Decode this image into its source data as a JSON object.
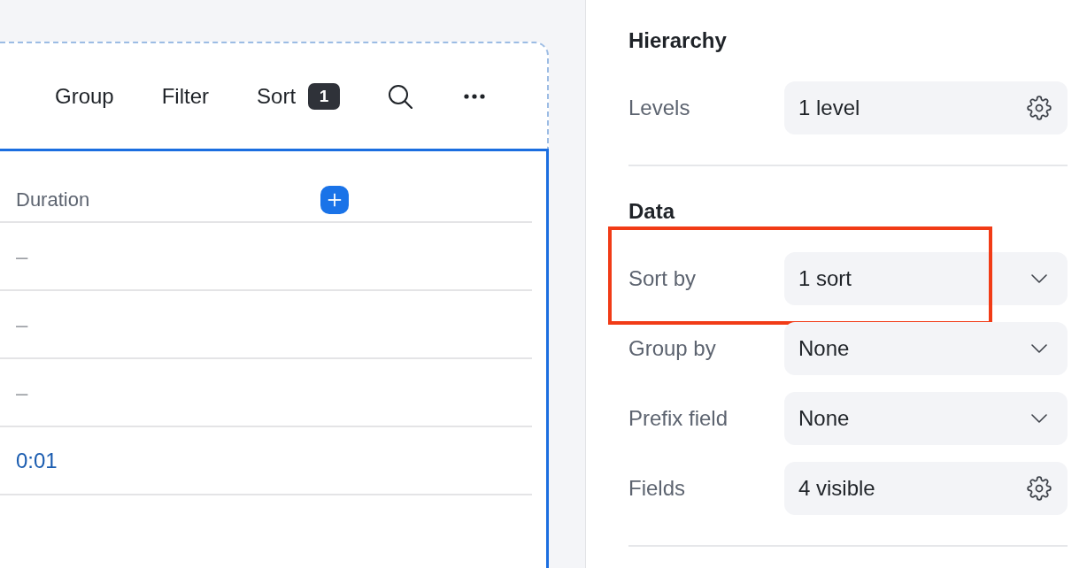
{
  "toolbar": {
    "buttons": [
      {
        "label": "Group"
      },
      {
        "label": "Filter"
      },
      {
        "label": "Sort",
        "badge": "1"
      }
    ]
  },
  "table": {
    "selected": true,
    "columns": [
      {
        "label": "Duration"
      }
    ],
    "rows": [
      {
        "kind": "empty",
        "duration": "–"
      },
      {
        "kind": "empty",
        "duration": "–"
      },
      {
        "kind": "empty",
        "duration": "–"
      },
      {
        "kind": "value",
        "duration": "0:01"
      }
    ]
  },
  "sidebar": {
    "sections": [
      {
        "title": "Hierarchy",
        "settings": [
          {
            "label": "Levels",
            "value": "1 level",
            "kind": "settings",
            "highlighted": false
          }
        ]
      },
      {
        "title": "Data",
        "settings": [
          {
            "label": "Sort by",
            "value": "1 sort",
            "kind": "select",
            "highlighted": true
          },
          {
            "label": "Group by",
            "value": "None",
            "kind": "select",
            "highlighted": false
          },
          {
            "label": "Prefix field",
            "value": "None",
            "kind": "select",
            "highlighted": false
          },
          {
            "label": "Fields",
            "value": "4 visible",
            "kind": "settings",
            "highlighted": false
          }
        ]
      }
    ]
  }
}
